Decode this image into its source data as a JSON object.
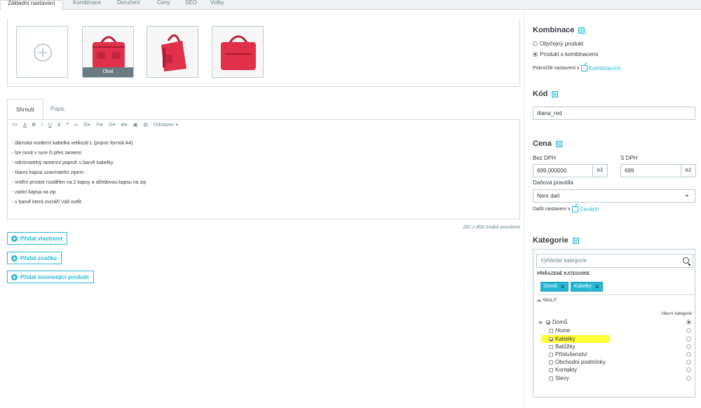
{
  "top_tabs": [
    {
      "label": "Základní nastavení",
      "active": true
    },
    {
      "label": "Kombinace"
    },
    {
      "label": "Doručení"
    },
    {
      "label": "Ceny"
    },
    {
      "label": "SEO"
    },
    {
      "label": "Volby"
    }
  ],
  "images": {
    "cover_label": "Obal"
  },
  "editor": {
    "tabs": [
      "Shrnutí",
      "Popis"
    ],
    "paragraph_format": "Odstavec",
    "lines": [
      "- dámská moderní kabelka velikosti L (pojme formát A4)",
      "- lze nosit v ruce či přes rameno",
      "- odnímatelný ramenní popruh v barvě kabelky",
      "- hlavní kapsa uzavíratelní zipem",
      "- vnitřní prostor rozdělen na 2 kapsy a středovou kapsu na zip",
      "- zadní kapsa na zip",
      "- v barvě která rozzáří Váš outfit"
    ],
    "char_count": "281 z 800 znaků povoleno"
  },
  "buttons": {
    "add_feature": "Přidat vlastnost",
    "add_brand": "Přidat značku",
    "add_related": "Přidat související produkt"
  },
  "combinations": {
    "title": "Kombinace",
    "option_simple": "Obyčejný produkt",
    "option_combinations": "Produkt s kombinacemi",
    "advanced_note": "Pokročilé nastavení v",
    "advanced_link": "Kombinacích"
  },
  "code": {
    "title": "Kód",
    "value": "diana_red"
  },
  "price": {
    "title": "Cena",
    "without_tax_label": "Bez DPH",
    "with_tax_label": "S DPH",
    "without_tax_value": "699,000000",
    "with_tax_value": "699",
    "currency": "Kč",
    "tax_rule_label": "Daňová pravidla",
    "tax_rule_value": "Není daň",
    "more_note": "Další nastavení v",
    "more_link": "Cenách"
  },
  "category": {
    "title": "Kategorie",
    "search_placeholder": "Vyhledat kategorie",
    "assigned_heading": "PŘIŘAZENÉ KATEGORIE",
    "tags": [
      "Domů",
      "Kabelky"
    ],
    "collapse": "SBALIT",
    "main_category_label": "Hlavní kategorie",
    "tree": [
      {
        "label": "Domů",
        "checked": true,
        "level": 0,
        "main": true
      },
      {
        "label": "Home",
        "checked": false,
        "level": 1,
        "italic": true
      },
      {
        "label": "Kabelky",
        "checked": true,
        "level": 1,
        "highlighted": true
      },
      {
        "label": "Batůžky",
        "checked": false,
        "level": 1
      },
      {
        "label": "Příslušenství",
        "checked": false,
        "level": 1
      },
      {
        "label": "Obchodní podmínky",
        "checked": false,
        "level": 1
      },
      {
        "label": "Kontakty",
        "checked": false,
        "level": 1
      },
      {
        "label": "Slevy",
        "checked": false,
        "level": 1
      }
    ]
  },
  "colors": {
    "accent": "#25b9d7",
    "highlight": "#ffff33",
    "bag_red": "#e0304a"
  }
}
